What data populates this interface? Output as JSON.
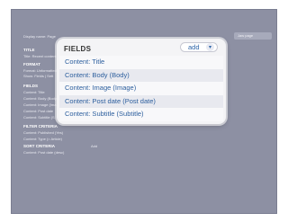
{
  "background": {
    "top_label": "Display name: Page",
    "dropdown": "Jaw page",
    "sections": [
      {
        "heading": "TITLE",
        "lines": [
          "Title: Recent content"
        ]
      },
      {
        "heading": "FORMAT",
        "lines": [
          "Format: Unformatted",
          "Show: Fields | Sett"
        ]
      },
      {
        "heading": "FIELDS",
        "lines": [
          "Content: Title",
          "Content: Body (Body)",
          "Content: Image (Ima",
          "Content: Post date",
          "Content: Subtitle (S"
        ]
      },
      {
        "heading": "FILTER CRITERIA",
        "lines": [
          "Content: Published (Yes)",
          "Content: Type (= Article)"
        ]
      },
      {
        "heading": "SORT CRITERIA",
        "lines": [
          "Content: Post date (desc)"
        ]
      }
    ],
    "small_dropdown": "Add"
  },
  "panel": {
    "title": "FIELDS",
    "add_button": "add",
    "add_arrow_icon": "chevron-down-icon",
    "fields": [
      "Content: Title",
      "Content: Body (Body)",
      "Content: Image (Image)",
      "Content: Post date (Post date)",
      "Content: Subtitle (Subtitle)"
    ]
  }
}
